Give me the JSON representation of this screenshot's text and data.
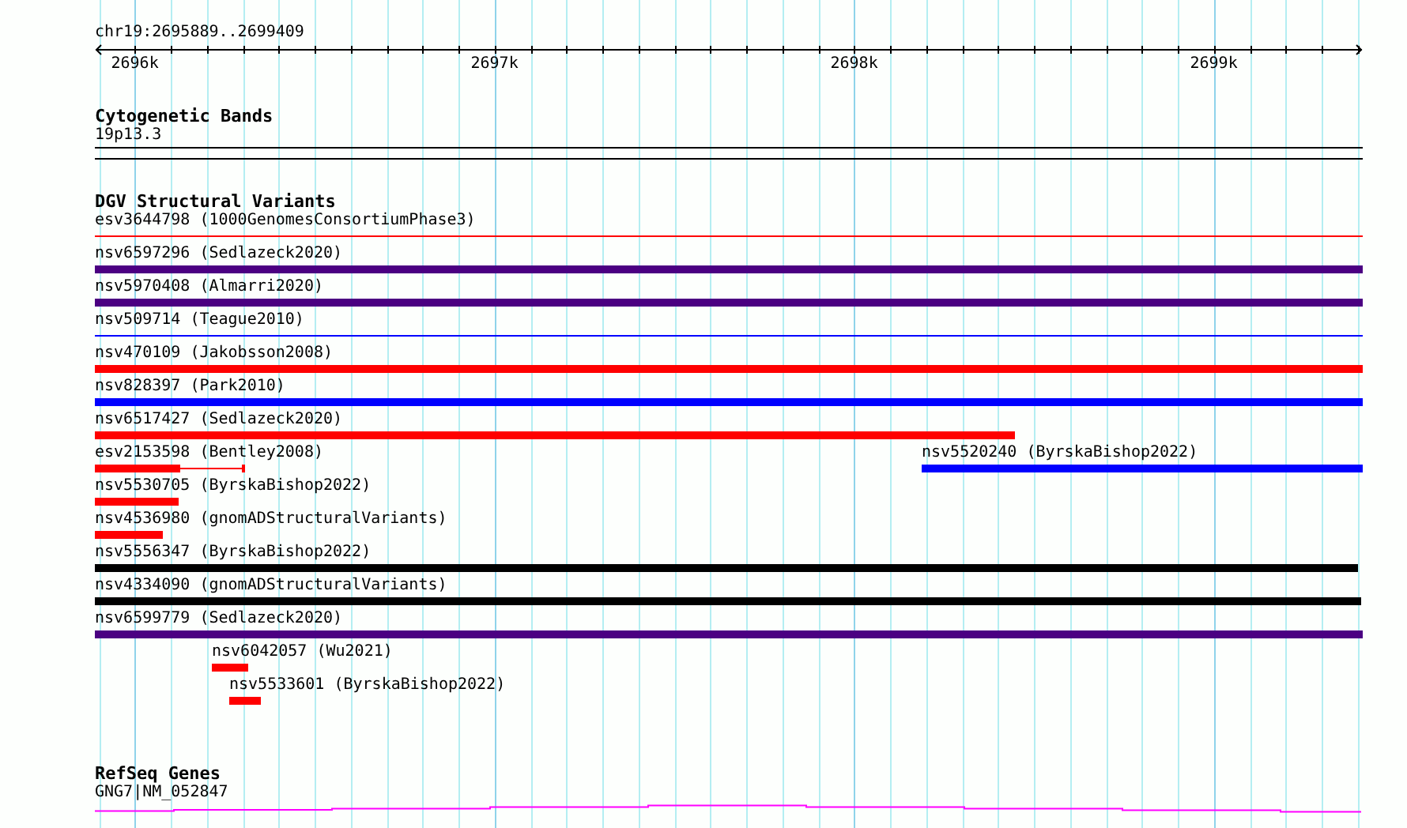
{
  "ruler": {
    "location": "chr19:2695889..2699409",
    "ticks": [
      "2696k",
      "2697k",
      "2698k",
      "2699k"
    ]
  },
  "tracks": [
    {
      "kind": "bands",
      "title": "Cytogenetic Bands",
      "features": [
        {
          "label": "19p13.3"
        }
      ]
    },
    {
      "kind": "variants",
      "title": "DGV Structural Variants",
      "rows": [
        [
          {
            "label": "esv3644798 (1000GenomesConsortiumPhase3)",
            "kind": "line",
            "color": "#ff0000"
          }
        ],
        [
          {
            "label": "nsv6597296 (Sedlazeck2020)",
            "kind": "bar",
            "color": "#4b0082"
          }
        ],
        [
          {
            "label": "nsv5970408 (Almarri2020)",
            "kind": "bar",
            "color": "#4b0082"
          }
        ],
        [
          {
            "label": "nsv509714 (Teague2010)",
            "kind": "line",
            "color": "#0000ff"
          }
        ],
        [
          {
            "label": "nsv470109 (Jakobsson2008)",
            "kind": "bar",
            "color": "#ff0000"
          }
        ],
        [
          {
            "label": "nsv828397 (Park2010)",
            "kind": "bar",
            "color": "#0000ff"
          }
        ],
        [
          {
            "label": "nsv6517427 (Sedlazeck2020)",
            "kind": "bar",
            "color": "#ff0000"
          }
        ],
        [
          {
            "label": "esv2153598 (Bentley2008)",
            "kind": "tailed",
            "color": "#ff0000"
          },
          {
            "label": "nsv5520240 (ByrskaBishop2022)",
            "kind": "bar",
            "color": "#0000ff"
          }
        ],
        [
          {
            "label": "nsv5530705 (ByrskaBishop2022)",
            "kind": "bar",
            "color": "#ff0000"
          }
        ],
        [
          {
            "label": "nsv4536980 (gnomADStructuralVariants)",
            "kind": "bar",
            "color": "#ff0000"
          }
        ],
        [
          {
            "label": "nsv5556347 (ByrskaBishop2022)",
            "kind": "bar",
            "color": "#000000"
          }
        ],
        [
          {
            "label": "nsv4334090 (gnomADStructuralVariants)",
            "kind": "bar",
            "color": "#000000"
          }
        ],
        [
          {
            "label": "nsv6599779 (Sedlazeck2020)",
            "kind": "bar",
            "color": "#4b0082"
          }
        ],
        [
          {
            "label": "nsv6042057 (Wu2021)",
            "kind": "bar",
            "color": "#ff0000"
          }
        ],
        [
          {
            "label": "nsv5533601 (ByrskaBishop2022)",
            "kind": "bar",
            "color": "#ff0000"
          }
        ]
      ]
    },
    {
      "kind": "genes",
      "title": "RefSeq Genes",
      "features": [
        {
          "label": "GNG7|NM_052847"
        }
      ]
    }
  ]
}
